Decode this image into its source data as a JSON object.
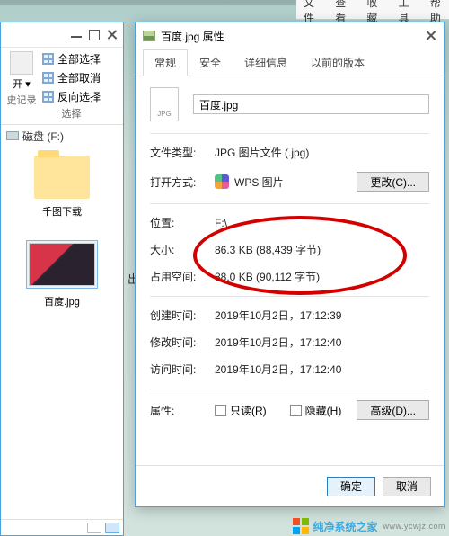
{
  "bg_menu": [
    "文件",
    "查看",
    "收藏",
    "工具",
    "帮助"
  ],
  "explorer": {
    "open_label": "开 ▾",
    "ribbon_items": [
      "全部选择",
      "全部取消",
      "反向选择"
    ],
    "ribbon_group": "选择",
    "history": "史记录",
    "location": "磁盘 (F:)",
    "folder_name": "千图下载",
    "image_name": "百度.jpg",
    "outside_char": "出"
  },
  "props": {
    "title": "百度.jpg 属性",
    "tabs": [
      "常规",
      "安全",
      "详细信息",
      "以前的版本"
    ],
    "file_ext": "JPG",
    "filename": "百度.jpg",
    "rows": {
      "filetype_l": "文件类型:",
      "filetype_v": "JPG 图片文件 (.jpg)",
      "openwith_l": "打开方式:",
      "openwith_v": "WPS 图片",
      "change_btn": "更改(C)...",
      "location_l": "位置:",
      "location_v": "F:\\",
      "size_l": "大小:",
      "size_v": "86.3 KB (88,439 字节)",
      "ondisk_l": "占用空间:",
      "ondisk_v": "88.0 KB (90,112 字节)",
      "created_l": "创建时间:",
      "created_v": "2019年10月2日，17:12:39",
      "modified_l": "修改时间:",
      "modified_v": "2019年10月2日，17:12:40",
      "accessed_l": "访问时间:",
      "accessed_v": "2019年10月2日，17:12:40",
      "attr_l": "属性:",
      "readonly": "只读(R)",
      "hidden": "隐藏(H)",
      "advanced": "高级(D)..."
    },
    "buttons": {
      "ok": "确定",
      "cancel": "取消"
    }
  },
  "watermark": {
    "main": "纯净系统之家",
    "sub": "www.ycwjz.com"
  }
}
